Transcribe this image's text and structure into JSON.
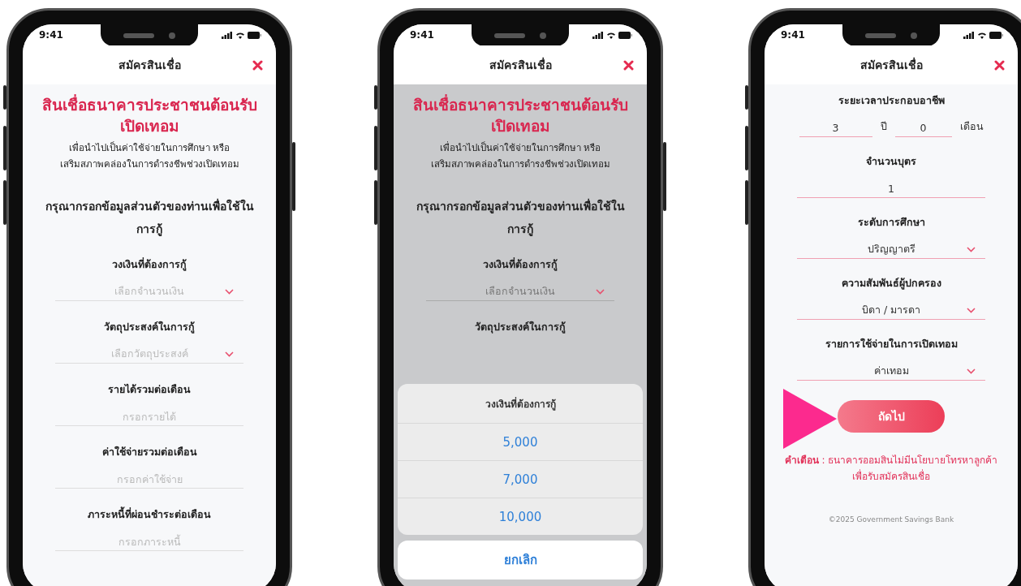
{
  "phones": [
    {
      "status_time": "9:41",
      "title": "สมัครสินเชื่อ",
      "dimmed": false,
      "heading": "สินเชื่อธนาคารประชาชนต้อนรับ\nเปิดเทอม",
      "subtitle": "เพื่อนำไปเป็นค่าใช้จ่ายในการศึกษา หรือ\nเสริมสภาพคล่องในการดำรงชีพช่วงเปิดเทอม",
      "instruction": "กรุณากรอกข้อมูลส่วนตัวของท่านเพื่อใช้ในการกู้",
      "fields": [
        {
          "kind": "select",
          "label": "วงเงินที่ต้องการกู้",
          "placeholder": "เลือกจำนวนเงิน"
        },
        {
          "kind": "select",
          "label": "วัตถุประสงค์ในการกู้",
          "placeholder": "เลือกวัตถุประสงค์"
        },
        {
          "kind": "text",
          "label": "รายได้รวมต่อเดือน",
          "placeholder": "กรอกรายได้"
        },
        {
          "kind": "text",
          "label": "ค่าใช้จ่ายรวมต่อเดือน",
          "placeholder": "กรอกค่าใช้จ่าย"
        },
        {
          "kind": "text",
          "label": "ภาระหนี้ที่ผ่อนชำระต่อเดือน",
          "placeholder": "กรอกภาระหนี้"
        }
      ]
    },
    {
      "status_time": "9:41",
      "title": "สมัครสินเชื่อ",
      "dimmed": true,
      "heading": "สินเชื่อธนาคารประชาชนต้อนรับ\nเปิดเทอม",
      "subtitle": "เพื่อนำไปเป็นค่าใช้จ่ายในการศึกษา หรือ\nเสริมสภาพคล่องในการดำรงชีพช่วงเปิดเทอม",
      "instruction": "กรุณากรอกข้อมูลส่วนตัวของท่านเพื่อใช้ในการกู้",
      "fields": [
        {
          "kind": "select",
          "label": "วงเงินที่ต้องการกู้",
          "placeholder": "เลือกจำนวนเงิน"
        },
        {
          "kind": "label",
          "label": "วัตถุประสงค์ในการกู้"
        }
      ],
      "action_sheet": {
        "title": "วงเงินที่ต้องการกู้",
        "options": [
          "5,000",
          "7,000",
          "10,000"
        ],
        "cancel": "ยกเลิก"
      }
    },
    {
      "status_time": "9:41",
      "title": "สมัครสินเชื่อ",
      "dimmed": false,
      "fields": [
        {
          "kind": "duration",
          "label": "ระยะเวลาประกอบอาชีพ",
          "parts": [
            {
              "value": "3",
              "unit": "ปี"
            },
            {
              "value": "0",
              "unit": "เดือน"
            }
          ]
        },
        {
          "kind": "text",
          "label": "จำนวนบุตร",
          "value": "1"
        },
        {
          "kind": "select",
          "label": "ระดับการศึกษา",
          "value": "ปริญญาตรี"
        },
        {
          "kind": "select",
          "label": "ความสัมพันธ์ผู้ปกครอง",
          "value": "บิดา / มารดา"
        },
        {
          "kind": "select",
          "label": "รายการใช้จ่ายในการเปิดเทอม",
          "value": "ค่าเทอม"
        }
      ],
      "next_button": "ถัดไป",
      "warning": "**คำเตือน** : ธนาคารออมสินไม่มีนโยบายโทรหาลูกค้าเพื่อรับสมัครสินเชื่อ",
      "footer": "©2025 Government Savings Bank"
    }
  ]
}
